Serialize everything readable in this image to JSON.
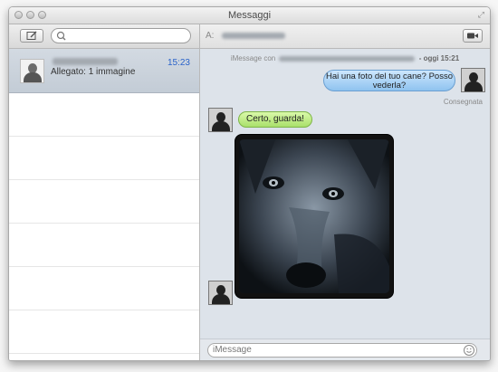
{
  "window": {
    "title": "Messaggi"
  },
  "sidebar": {
    "conversation": {
      "time": "15:23",
      "preview": "Allegato: 1 immagine"
    }
  },
  "conversation": {
    "to_label": "A:",
    "header_prefix": "iMessage con",
    "header_suffix": "- oggi 15:21",
    "messages": [
      {
        "from": "me",
        "text": "Hai una foto del tuo cane? Posso vederla?"
      },
      {
        "from": "them",
        "text": "Certo, guarda!"
      }
    ],
    "delivered": "Consegnata",
    "input_placeholder": "iMessage"
  },
  "colors": {
    "sent_bubble": "#8fc3ef",
    "received_bubble": "#a9e06b",
    "timestamp_blue": "#2a63c9",
    "selected_row": "#c8d0da"
  },
  "icons": [
    "compose-icon",
    "search-icon",
    "video-camera-icon",
    "emoji-icon",
    "fullscreen-icon",
    "user-avatar-icon"
  ]
}
